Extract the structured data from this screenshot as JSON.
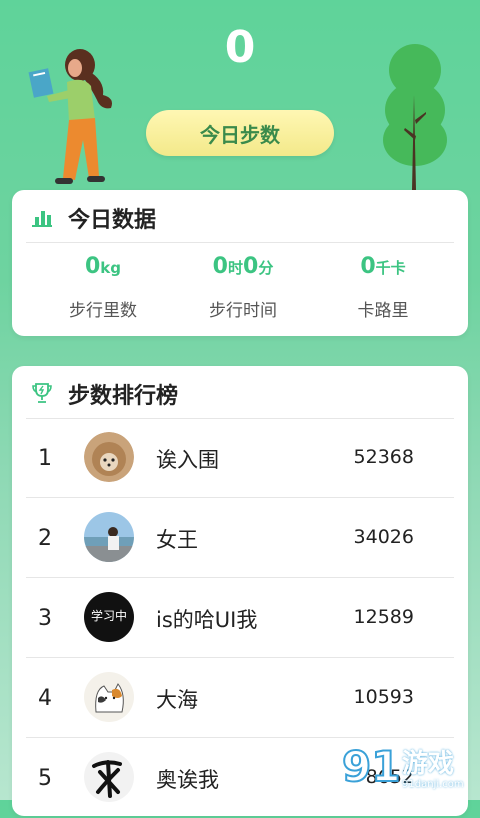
{
  "header": {
    "step_count": "0",
    "today_steps_label": "今日步数"
  },
  "today_data": {
    "title": "今日数据",
    "stats": [
      {
        "value": "0",
        "unit": "kg",
        "label": "步行里数"
      },
      {
        "value": "0",
        "unit": "时",
        "value2": "0",
        "unit2": "分",
        "label": "步行时间"
      },
      {
        "value": "0",
        "unit": "千卡",
        "label": "卡路里"
      }
    ]
  },
  "ranking": {
    "title": "步数排行榜",
    "rows": [
      {
        "rank": "1",
        "name": "诶入围",
        "steps": "52368",
        "avatar": "hedgehog-avatar"
      },
      {
        "rank": "2",
        "name": "女王",
        "steps": "34026",
        "avatar": "beach-person-avatar"
      },
      {
        "rank": "3",
        "name": "is的哈UI我",
        "steps": "12589",
        "avatar": "studying-text-avatar",
        "avatar_text": "学习中"
      },
      {
        "rank": "4",
        "name": "大海",
        "steps": "10593",
        "avatar": "cat-painting-avatar"
      },
      {
        "rank": "5",
        "name": "奥诶我",
        "steps": "8652",
        "avatar": "calligraphy-avatar"
      }
    ]
  },
  "watermark": {
    "brand": "游戏",
    "site": "91danji.com"
  },
  "colors": {
    "accent_green": "#3cc482",
    "button_yellow": "#f3e98a",
    "button_text": "#3a8a4b"
  }
}
